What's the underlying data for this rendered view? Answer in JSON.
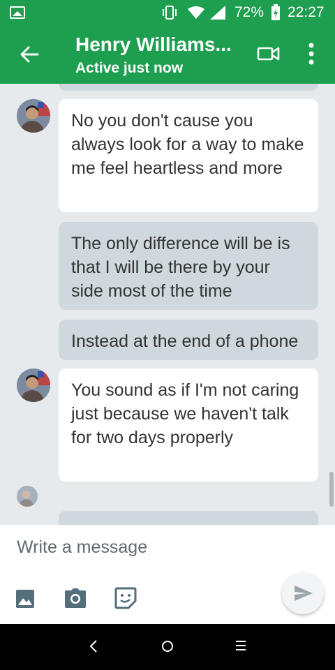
{
  "status_bar": {
    "battery_percent": "72%",
    "time": "22:27",
    "icons": [
      "gallery-icon",
      "vibrate-icon",
      "wifi-icon",
      "signal-icon",
      "battery-charging-icon"
    ]
  },
  "header": {
    "contact_name": "Henry Williams...",
    "contact_status": "Active just now",
    "icons": [
      "back-arrow-icon",
      "video-call-icon",
      "more-vert-icon"
    ]
  },
  "messages": [
    {
      "direction": "incoming",
      "text": "No you don't cause you always look for a way to make me feel heartless and more"
    },
    {
      "direction": "outgoing",
      "text": "The only difference will be is that I will be there by your side most of the time"
    },
    {
      "direction": "outgoing",
      "text": "Instead at the end of a phone"
    },
    {
      "direction": "incoming",
      "text": "You sound as if I'm not caring just because we haven't talk for two days properly"
    }
  ],
  "compose": {
    "placeholder": "Write a message",
    "icons": [
      "image-icon",
      "camera-icon",
      "sticker-icon",
      "send-icon"
    ]
  },
  "nav_bar": {
    "icons": [
      "nav-back-icon",
      "nav-home-icon",
      "nav-recents-icon"
    ]
  },
  "colors": {
    "brand_green": "#1e9e4f",
    "chat_background": "#e7eaec",
    "incoming_bubble": "#ffffff",
    "outgoing_bubble": "#cfd8dc",
    "icon_gray": "#546e7a"
  }
}
